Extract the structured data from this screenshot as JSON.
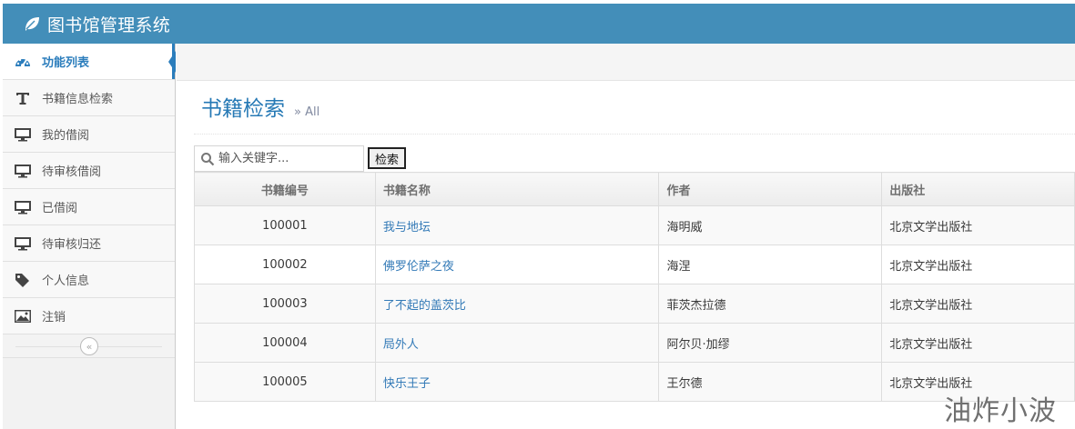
{
  "app": {
    "title": "图书馆管理系统",
    "logo_icon": "leaf-icon"
  },
  "sidebar": {
    "items": [
      {
        "label": "功能列表",
        "icon": "dashboard-icon",
        "active": true
      },
      {
        "label": "书籍信息检索",
        "icon": "text-icon"
      },
      {
        "label": "我的借阅",
        "icon": "desktop-icon"
      },
      {
        "label": "待审核借阅",
        "icon": "desktop-icon"
      },
      {
        "label": "已借阅",
        "icon": "desktop-icon"
      },
      {
        "label": "待审核归还",
        "icon": "desktop-icon"
      },
      {
        "label": "个人信息",
        "icon": "tag-icon"
      },
      {
        "label": "注销",
        "icon": "picture-icon"
      }
    ],
    "collapse_icon": "double-angle-left-icon"
  },
  "page": {
    "title": "书籍检索",
    "subtitle": "» All"
  },
  "search": {
    "placeholder": "输入关键字...",
    "value": "",
    "button_label": "检索",
    "icon": "search-icon"
  },
  "table": {
    "headers": [
      "书籍编号",
      "书籍名称",
      "作者",
      "出版社"
    ],
    "rows": [
      [
        "100001",
        "我与地坛",
        "海明威",
        "北京文学出版社"
      ],
      [
        "100002",
        "佛罗伦萨之夜",
        "海涅",
        "北京文学出版社"
      ],
      [
        "100003",
        "了不起的盖茨比",
        "菲茨杰拉德",
        "北京文学出版社"
      ],
      [
        "100004",
        "局外人",
        "阿尔贝·加缪",
        "北京文学出版社"
      ],
      [
        "100005",
        "快乐王子",
        "王尔德",
        "北京文学出版社"
      ]
    ]
  },
  "watermark": "油炸小波",
  "colors": {
    "navbar": "#438eb9",
    "accent": "#2b7dbc",
    "link": "#337ab7"
  }
}
